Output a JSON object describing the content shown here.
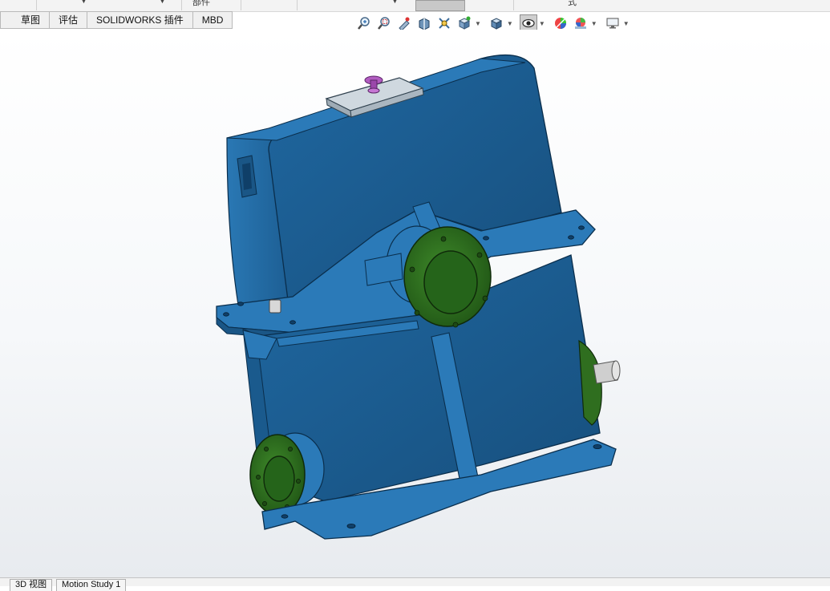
{
  "top_strip": {
    "part_label": "部件",
    "right_fragment": "式"
  },
  "command_tabs": [
    {
      "label": "草图"
    },
    {
      "label": "评估"
    },
    {
      "label": "SOLIDWORKS 插件"
    },
    {
      "label": "MBD"
    }
  ],
  "view_toolbar": {
    "buttons": [
      {
        "icon": "zoom-to-fit-icon"
      },
      {
        "icon": "zoom-to-area-icon"
      },
      {
        "icon": "previous-view-icon"
      },
      {
        "icon": "section-view-icon"
      },
      {
        "icon": "dynamic-annotation-icon"
      },
      {
        "icon": "view-orientation-icon",
        "dropdown": true
      },
      {
        "icon": "display-style-icon",
        "dropdown": true
      },
      {
        "icon": "hide-show-items-icon",
        "dropdown": true,
        "active": true
      },
      {
        "icon": "edit-appearance-icon"
      },
      {
        "icon": "apply-scene-icon",
        "dropdown": true
      },
      {
        "icon": "view-settings-icon",
        "dropdown": true
      }
    ]
  },
  "model": {
    "body_color": "#1d5f92",
    "edge_color": "#0a2e4c",
    "flange_color": "#2f6e1f",
    "shaft_color": "#c9c9c9",
    "breather_color": "#b15cc0"
  },
  "bottom_tabs": [
    {
      "label": "3D 视图"
    },
    {
      "label": "Motion Study 1"
    }
  ]
}
